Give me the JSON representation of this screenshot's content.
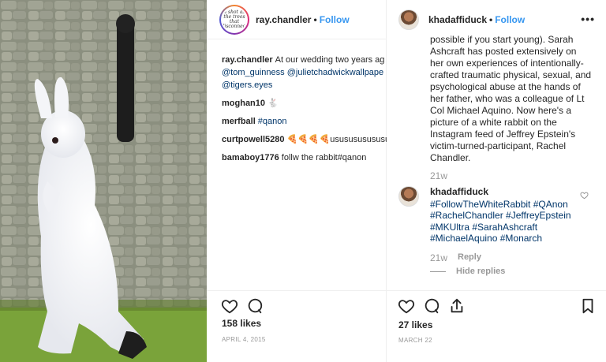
{
  "middle_post": {
    "avatar_text": "a shot as the trees that disconnect",
    "username": "ray.chandler",
    "separator": "•",
    "follow_label": "Follow",
    "caption_user": "ray.chandler",
    "caption_text": "At our wedding two years ag",
    "caption_tags_line2": "@tom_guinness @julietchadwickwallpape",
    "caption_tags_line3": "@tigers.eyes",
    "comments": [
      {
        "user": "moghan10",
        "text": "🐇"
      },
      {
        "user": "merfball",
        "text": "#qanon"
      },
      {
        "user": "curtpowell5280",
        "text": "🍕🍕🍕🍕ususususususus"
      },
      {
        "user": "bamaboy1776",
        "text": "follw the rabbit#qanon"
      }
    ],
    "likes": "158 likes",
    "date": "APRIL 4, 2015"
  },
  "right_post": {
    "username": "khadaffiduck",
    "separator": "•",
    "follow_label": "Follow",
    "more_label": "•••",
    "body_top": "possible if you start young). Sarah Ashcraft has posted extensively on her own experiences of intentionally-crafted traumatic physical, sexual, and psychological abuse at the hands of her father, who was a colleague of Lt Col Michael Aquino. Now here's a picture of a white rabbit on the Instagram feed of Jeffrey Epstein's victim-turned-participant, Rachel Chandler.",
    "time1": "21w",
    "comment_user": "khadaffiduck",
    "comment_tags": "#FollowTheWhiteRabbit #QAnon #RachelChandler #JeffreyEpstein #MKUltra #SarahAshcraft #MichaelAquino #Monarch",
    "time2": "21w",
    "reply_label": "Reply",
    "hide_replies_label": "Hide replies",
    "likes": "27 likes",
    "date": "MARCH 22"
  },
  "colors": {
    "link_blue": "#3897f0",
    "hashtag": "#003569",
    "meta_gray": "#999999",
    "text": "#262626"
  }
}
